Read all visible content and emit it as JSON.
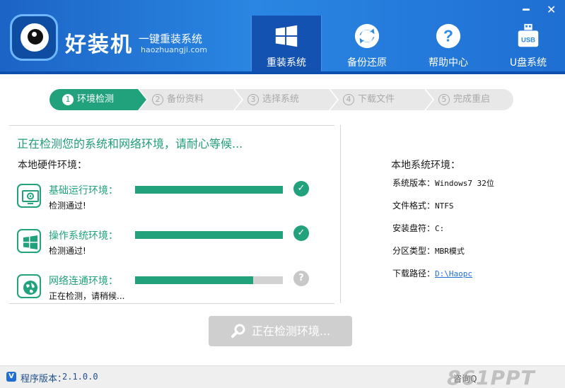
{
  "app": {
    "brand": "好装机",
    "slogan": "一键重装系统",
    "url": "haozhuangji.com"
  },
  "window_controls": {
    "minimize": "━",
    "close": "✕"
  },
  "nav": [
    {
      "label": "重装系统",
      "icon": "windows-logo-icon",
      "active": true
    },
    {
      "label": "备份还原",
      "icon": "refresh-icon",
      "active": false
    },
    {
      "label": "帮助中心",
      "icon": "question-icon",
      "active": false
    },
    {
      "label": "U盘系统",
      "icon": "usb-icon",
      "active": false
    }
  ],
  "steps": [
    {
      "num": "1",
      "label": "环境检测",
      "active": true
    },
    {
      "num": "2",
      "label": "备份资料",
      "active": false
    },
    {
      "num": "3",
      "label": "选择系统",
      "active": false
    },
    {
      "num": "4",
      "label": "下载文件",
      "active": false
    },
    {
      "num": "5",
      "label": "完成重启",
      "active": false
    }
  ],
  "status_title": "正在检测您的系统和网络环境，请耐心等候...",
  "hardware": {
    "title": "本地硬件环境：",
    "rows": [
      {
        "label": "基础运行环境：",
        "status": "检测通过!",
        "progress": 1.0,
        "icon": "monitor-settings-icon",
        "state": "✓"
      },
      {
        "label": "操作系统环境：",
        "status": "检测通过!",
        "progress": 1.0,
        "icon": "windows-logo-icon",
        "state": "✓"
      },
      {
        "label": "网络连通环境：",
        "status": "正在检测，请稍候...",
        "progress": 0.8,
        "icon": "globe-icon",
        "state": "?"
      }
    ]
  },
  "system": {
    "title": "本地系统环境：",
    "rows": [
      {
        "label": "系统版本：",
        "value": "Windows7  32位"
      },
      {
        "label": "文件格式：",
        "value": "NTFS"
      },
      {
        "label": "安装盘符：",
        "value": "C:"
      },
      {
        "label": "分区类型：",
        "value": "MBR模式"
      },
      {
        "label": "下载路径：",
        "value": "D:\\Haopc"
      }
    ]
  },
  "action_button": "正在检测环境...",
  "footer": {
    "version_badge": "V",
    "version_label": "程序版本：",
    "version": "2.1.0.0",
    "consult": "咨询Q",
    "watermark": "861PPT"
  },
  "colors": {
    "brand_blue": "#1f6fd3",
    "accent_green": "#22a27c"
  }
}
